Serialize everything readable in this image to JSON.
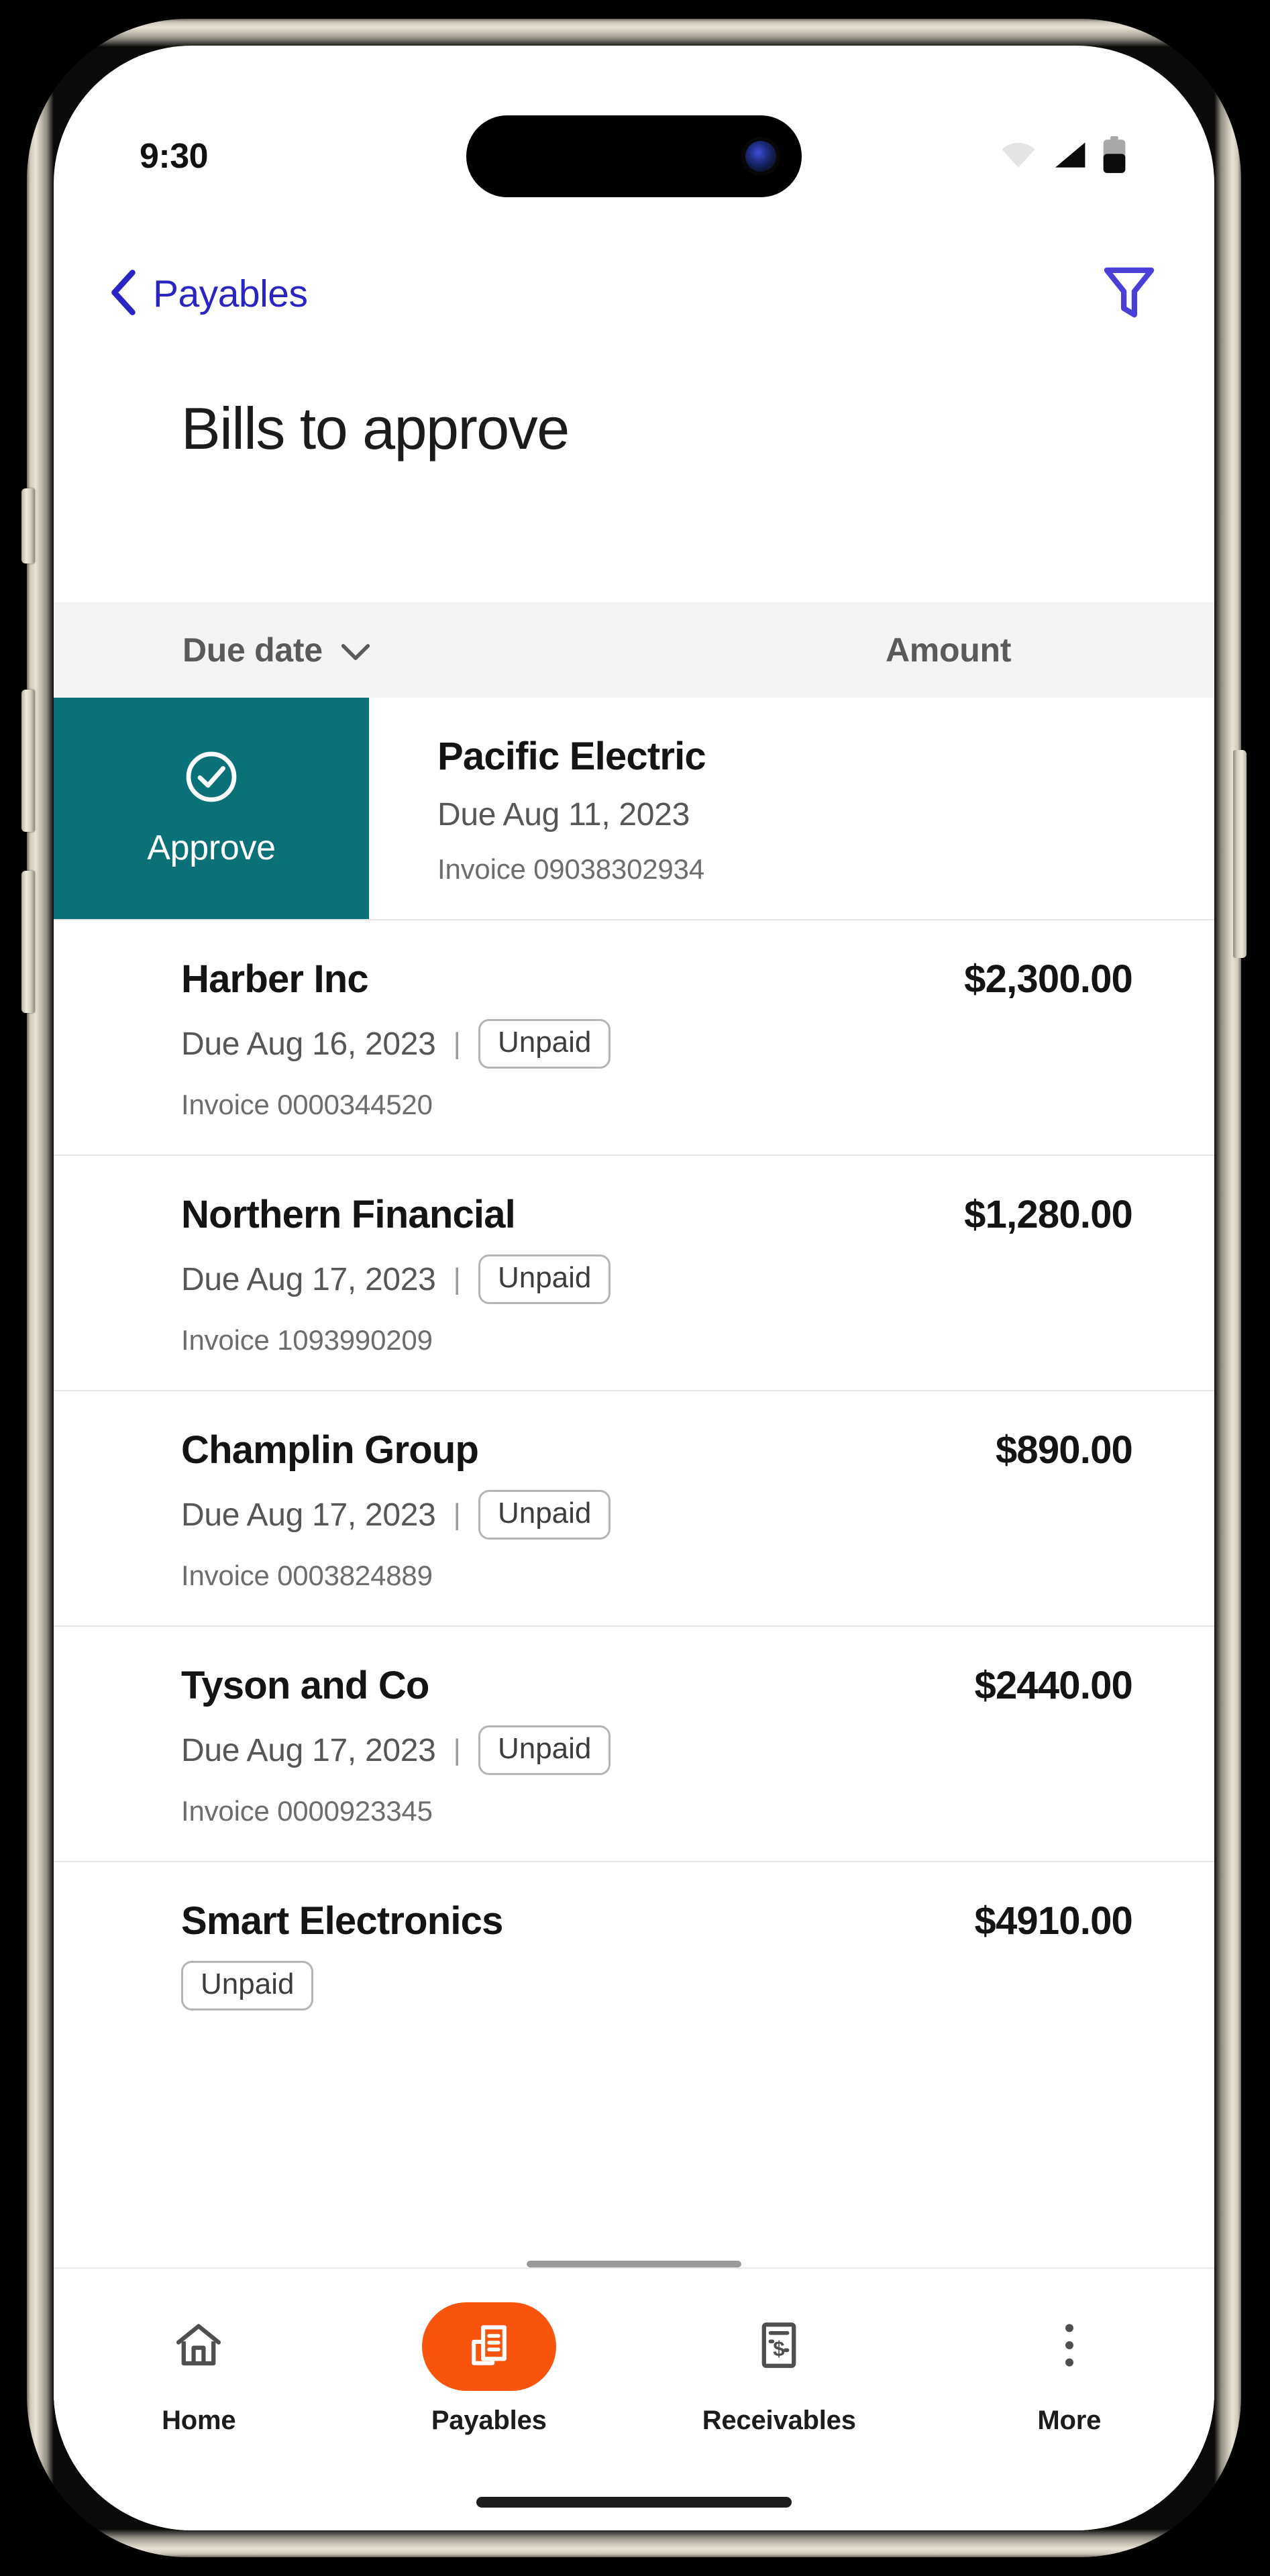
{
  "status_bar": {
    "time": "9:30",
    "icons": [
      "wifi-icon",
      "cellular-signal-icon",
      "battery-icon"
    ],
    "battery_level_pct": 55
  },
  "nav_bar": {
    "back_label": "Payables",
    "back_icon": "chevron-left-icon",
    "filter_icon": "filter-funnel-icon",
    "accent_color": "#2a25c2"
  },
  "page_title": "Bills to approve",
  "table_header": {
    "due_date": "Due date",
    "sort_icon": "chevron-down-icon",
    "amount": "Amount"
  },
  "swipe_action": {
    "label": "Approve",
    "icon": "check-circle-icon",
    "background_color": "#0b7179"
  },
  "bills": [
    {
      "vendor": "Pacific Electric",
      "amount": "$",
      "due": "Due Aug 11, 2023",
      "status": "",
      "invoice": "Invoice 09038302934",
      "swiped": true
    },
    {
      "vendor": "Harber Inc",
      "amount": "$2,300.00",
      "due": "Due Aug 16, 2023",
      "status": "Unpaid",
      "invoice": "Invoice 0000344520",
      "swiped": false
    },
    {
      "vendor": "Northern Financial",
      "amount": "$1,280.00",
      "due": "Due Aug 17, 2023",
      "status": "Unpaid",
      "invoice": "Invoice 1093990209",
      "swiped": false
    },
    {
      "vendor": "Champlin Group",
      "amount": "$890.00",
      "due": "Due Aug 17, 2023",
      "status": "Unpaid",
      "invoice": "Invoice 0003824889",
      "swiped": false
    },
    {
      "vendor": "Tyson and Co",
      "amount": "$2440.00",
      "due": "Due Aug 17, 2023",
      "status": "Unpaid",
      "invoice": "Invoice 0000923345",
      "swiped": false
    },
    {
      "vendor": "Smart Electronics",
      "amount": "$4910.00",
      "due": "",
      "status": "Unpaid",
      "invoice": "",
      "swiped": false
    }
  ],
  "tab_bar": {
    "active_color": "#f9540c",
    "items": [
      {
        "label": "Home",
        "icon": "home-icon",
        "active": false
      },
      {
        "label": "Payables",
        "icon": "documents-stack-icon",
        "active": true
      },
      {
        "label": "Receivables",
        "icon": "invoice-dollar-icon",
        "active": false
      },
      {
        "label": "More",
        "icon": "more-vertical-icon",
        "active": false
      }
    ]
  }
}
